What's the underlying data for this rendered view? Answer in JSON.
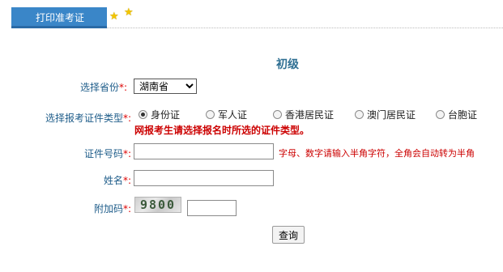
{
  "header": {
    "tab_label": "打印准考证"
  },
  "page_title": "初级",
  "form": {
    "province": {
      "label": "选择省份",
      "required": "*:",
      "value": "湖南省"
    },
    "id_type": {
      "label": "选择报考证件类型",
      "required": "*:",
      "options": [
        "身份证",
        "军人证",
        "香港居民证",
        "澳门居民证",
        "台胞证"
      ],
      "selected_index": 0,
      "warning": "网报考生请选择报名时所选的证件类型。"
    },
    "id_number": {
      "label": "证件号码",
      "required": "*:",
      "value": "",
      "hint": "字母、数字请输入半角字符，全角会自动转为半角"
    },
    "name": {
      "label": "姓名",
      "required": "*:",
      "value": ""
    },
    "captcha": {
      "label": "附加码",
      "required": "*:",
      "image_text": "9800",
      "value": ""
    },
    "submit_label": "查询"
  },
  "colors": {
    "tab_bg": "#3a86c8",
    "label_text": "#1f5d8a",
    "warning_text": "#cc0000",
    "star": "#f2c500"
  }
}
